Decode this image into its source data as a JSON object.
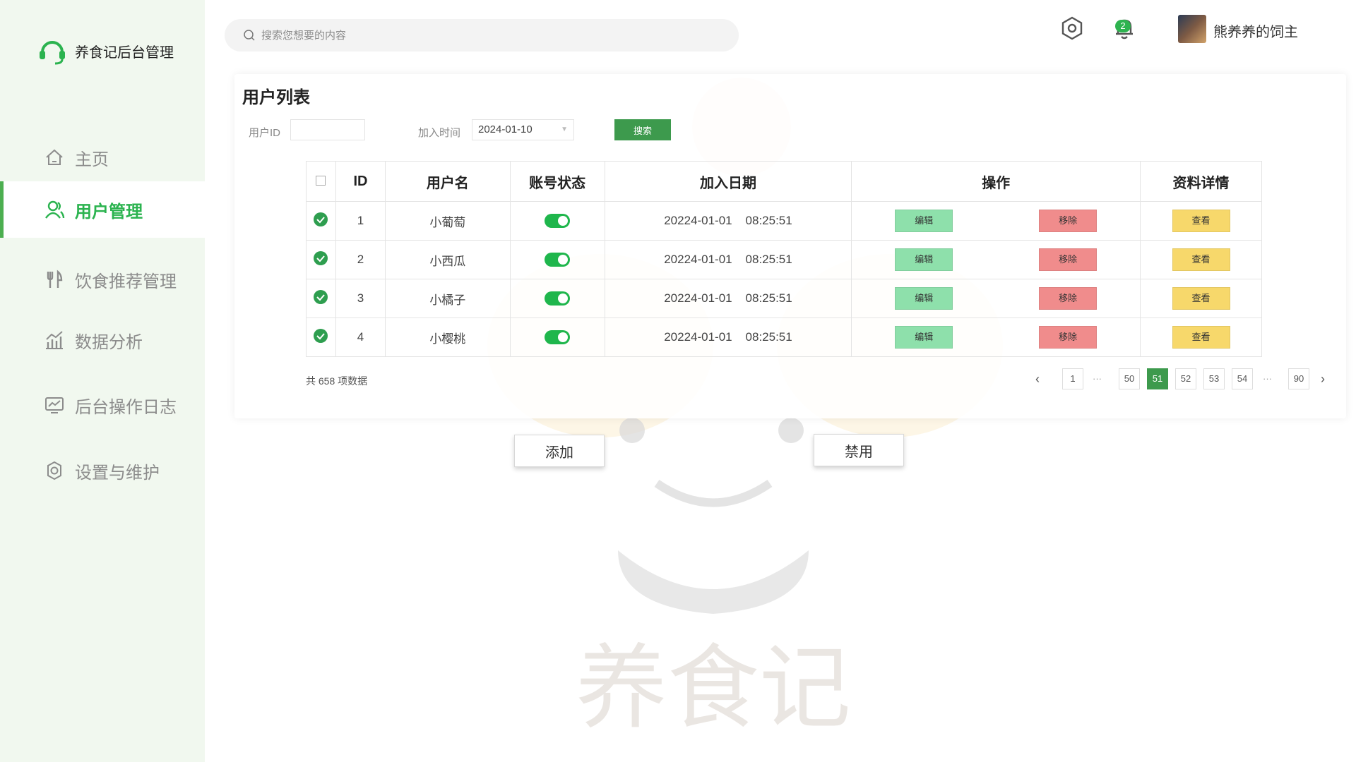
{
  "app": {
    "title": "养食记后台管理"
  },
  "sidebar": {
    "items": [
      {
        "label": "主页",
        "icon": "home-icon",
        "active": false
      },
      {
        "label": "用户管理",
        "icon": "user-icon",
        "active": true
      },
      {
        "label": "饮食推荐管理",
        "icon": "fork-knife-icon",
        "active": false
      },
      {
        "label": "数据分析",
        "icon": "chart-icon",
        "active": false
      },
      {
        "label": "后台操作日志",
        "icon": "monitor-icon",
        "active": false
      },
      {
        "label": "设置与维护",
        "icon": "settings-icon",
        "active": false
      }
    ]
  },
  "header": {
    "search_placeholder": "搜索您想要的内容",
    "notification_count": "2",
    "username": "熊养养的饲主"
  },
  "page": {
    "title": "用户列表",
    "filters": {
      "user_id_label": "用户ID",
      "user_id_value": "",
      "join_time_label": "加入时间",
      "join_time_value": "2024-01-10",
      "search_button": "搜索"
    },
    "table": {
      "columns": [
        "ID",
        "用户名",
        "账号状态",
        "加入日期",
        "操作",
        "资料详情"
      ],
      "rows": [
        {
          "id": "1",
          "name": "小葡萄",
          "status": true,
          "date": "20224-01-01",
          "time": "08:25:51",
          "edit": "编辑",
          "remove": "移除",
          "view": "查看"
        },
        {
          "id": "2",
          "name": "小西瓜",
          "status": true,
          "date": "20224-01-01",
          "time": "08:25:51",
          "edit": "编辑",
          "remove": "移除",
          "view": "查看"
        },
        {
          "id": "3",
          "name": "小橘子",
          "status": true,
          "date": "20224-01-01",
          "time": "08:25:51",
          "edit": "编辑",
          "remove": "移除",
          "view": "查看"
        },
        {
          "id": "4",
          "name": "小樱桃",
          "status": true,
          "date": "20224-01-01",
          "time": "08:25:51",
          "edit": "编辑",
          "remove": "移除",
          "view": "查看"
        }
      ]
    },
    "total_text": "共 658 项数据",
    "pagination": {
      "pages": [
        "1",
        "50",
        "51",
        "52",
        "53",
        "54",
        "90"
      ],
      "current": "51",
      "ellipsis": "···",
      "prev": "‹",
      "next": "›"
    },
    "actions": {
      "add": "添加",
      "disable": "禁用"
    }
  },
  "watermark": {
    "text": "养食记"
  },
  "colors": {
    "brand_green": "#2bb34f",
    "sidebar_bg": "#f1f8ef",
    "edit": "#8ee0ab",
    "remove": "#f08c8c",
    "view": "#f7d86b",
    "page_active": "#3d9a4d"
  }
}
